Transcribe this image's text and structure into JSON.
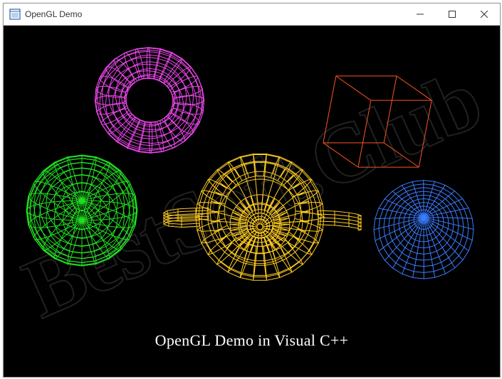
{
  "window": {
    "title": "OpenGL Demo"
  },
  "scene": {
    "caption": "OpenGL Demo in Visual C++",
    "shapes": {
      "torus_color": "#e846e8",
      "sphere_color": "#22e022",
      "cube_color": "#ff5522",
      "teapot_color": "#ffcc22",
      "cone_color": "#3a7cff"
    }
  },
  "watermark": "BestSoft.Club"
}
